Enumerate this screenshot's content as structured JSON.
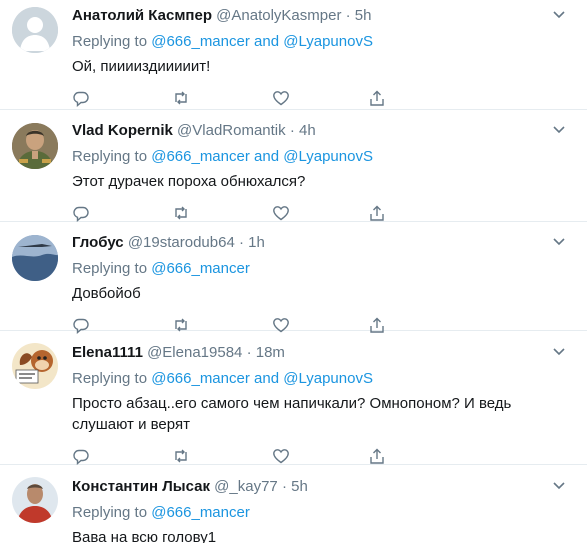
{
  "colors": {
    "link": "#1b95e0",
    "muted": "#657786",
    "text": "#14171a",
    "divider": "#e6ecf0"
  },
  "icons": {
    "reply": "reply-icon",
    "retweet": "retweet-icon",
    "like": "heart-icon",
    "share": "share-icon",
    "menu": "chevron-down-icon"
  },
  "tweets": [
    {
      "name": "Анатолий Касмпер",
      "handle": "@AnatolyKasmper",
      "sep": "·",
      "time": "5h",
      "replying_prefix": "Replying to",
      "mention1": "@666_mancer",
      "and": "and",
      "mention2": "@LyapunovS",
      "text": "Ой, пииииздииииит!"
    },
    {
      "name": "Vlad Kopernik",
      "handle": "@VladRomantik",
      "sep": "·",
      "time": "4h",
      "replying_prefix": "Replying to",
      "mention1": "@666_mancer",
      "and": "and",
      "mention2": "@LyapunovS",
      "text": "Этот дурачек пороха обнюхался?"
    },
    {
      "name": "Глобус",
      "handle": "@19starodub64",
      "sep": "·",
      "time": "1h",
      "replying_prefix": "Replying to",
      "mention1": "@666_mancer",
      "text": "Довбойоб"
    },
    {
      "name": "Elena1111",
      "handle": "@Elena19584",
      "sep": "·",
      "time": "18m",
      "replying_prefix": "Replying to",
      "mention1": "@666_mancer",
      "and": "and",
      "mention2": "@LyapunovS",
      "text_line1": "Просто абзац..его самого чем напичкали? Омнопоном? И ведь",
      "text_line2": "слушают и верят"
    },
    {
      "name": "Константин Лысак",
      "handle": "@_kay77",
      "sep": "·",
      "time": "5h",
      "replying_prefix": "Replying to",
      "mention1": "@666_mancer",
      "text": "Вава на всю голову1"
    }
  ]
}
